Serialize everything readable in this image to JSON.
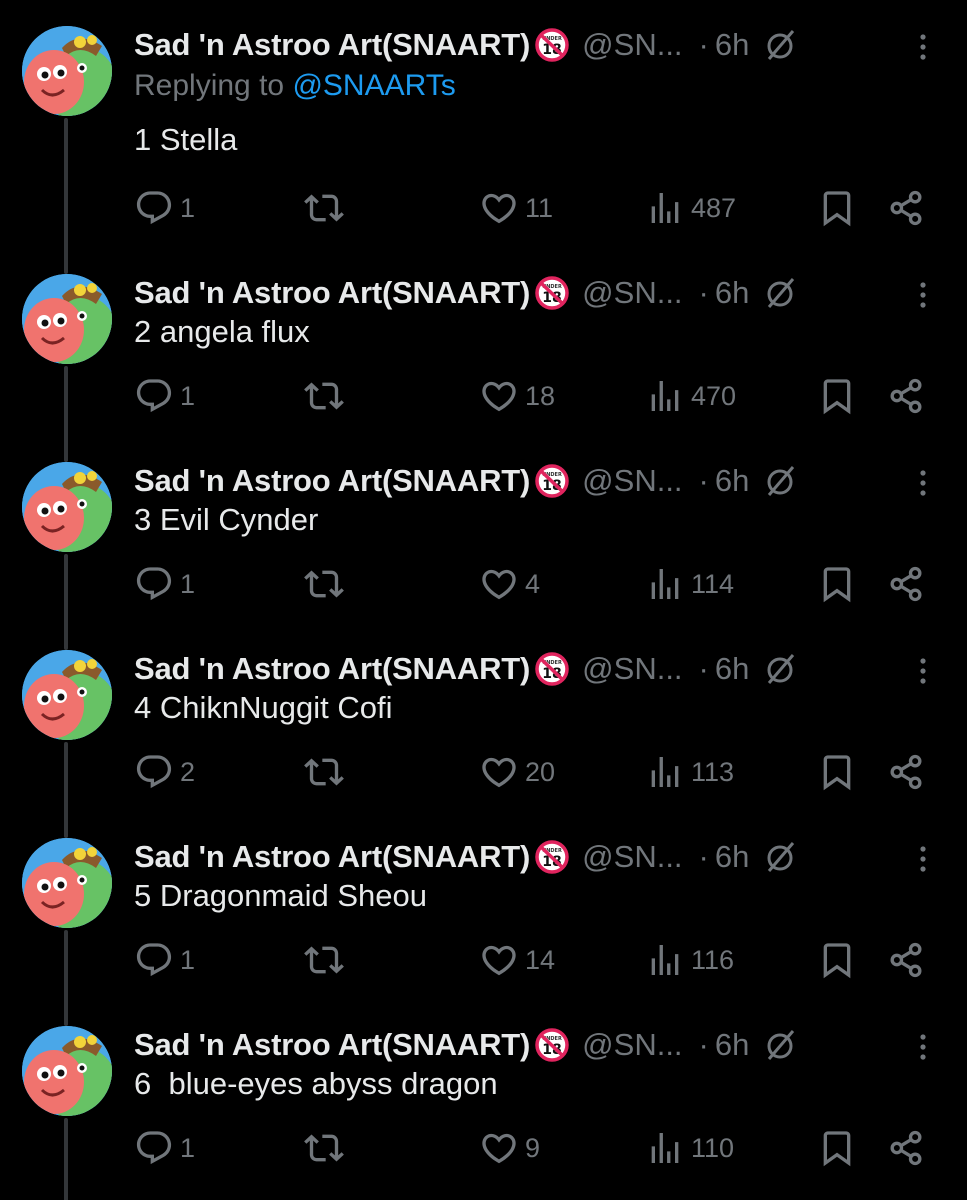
{
  "reply_to": {
    "prefix": "Replying to ",
    "mention": "@SNAARTs"
  },
  "colors": {
    "background": "#000000",
    "text": "#e7e9ea",
    "muted": "#71767b",
    "link": "#1d9bf0",
    "thread_line": "#333639"
  },
  "tweets": [
    {
      "name": "Sad 'n Astroo Art(SNAART)",
      "badge": "under-18-icon",
      "handle": "@SN...",
      "sep": "·",
      "time": "6h",
      "text": "1 Stella",
      "replies": "1",
      "reposts": "",
      "likes": "11",
      "views": "487"
    },
    {
      "name": "Sad 'n Astroo Art(SNAART)",
      "badge": "under-18-icon",
      "handle": "@SN...",
      "sep": "·",
      "time": "6h",
      "text": "2 angela flux",
      "replies": "1",
      "reposts": "",
      "likes": "18",
      "views": "470"
    },
    {
      "name": "Sad 'n Astroo Art(SNAART)",
      "badge": "under-18-icon",
      "handle": "@SN...",
      "sep": "·",
      "time": "6h",
      "text": "3 Evil Cynder",
      "replies": "1",
      "reposts": "",
      "likes": "4",
      "views": "114"
    },
    {
      "name": "Sad 'n Astroo Art(SNAART)",
      "badge": "under-18-icon",
      "handle": "@SN...",
      "sep": "·",
      "time": "6h",
      "text": "4 ChiknNuggit Cofi",
      "replies": "2",
      "reposts": "",
      "likes": "20",
      "views": "113"
    },
    {
      "name": "Sad 'n Astroo Art(SNAART)",
      "badge": "under-18-icon",
      "handle": "@SN...",
      "sep": "·",
      "time": "6h",
      "text": "5 Dragonmaid Sheou",
      "replies": "1",
      "reposts": "",
      "likes": "14",
      "views": "116"
    },
    {
      "name": "Sad 'n Astroo Art(SNAART)",
      "badge": "under-18-icon",
      "handle": "@SN...",
      "sep": "·",
      "time": "6h",
      "text": "6  blue-eyes abyss dragon",
      "replies": "1",
      "reposts": "",
      "likes": "9",
      "views": "110"
    }
  ]
}
